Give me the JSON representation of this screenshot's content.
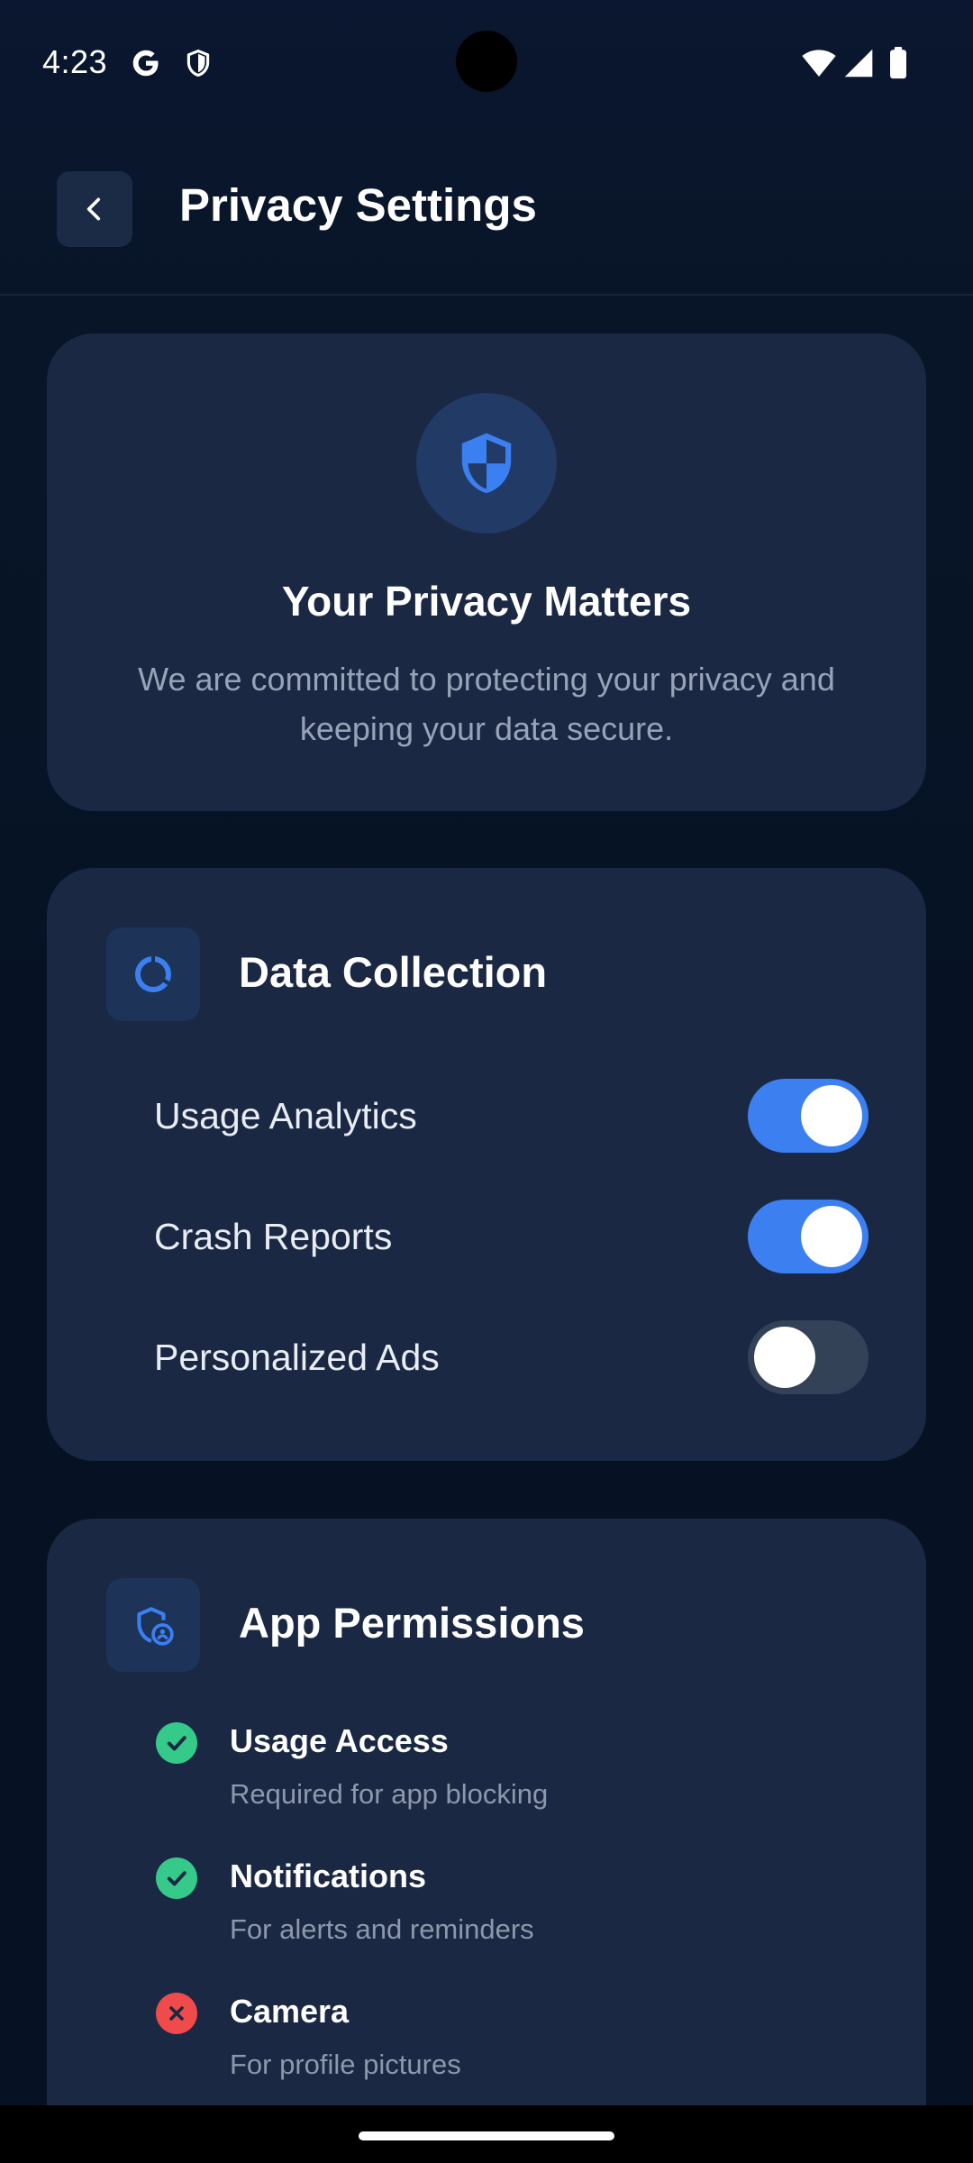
{
  "status_bar": {
    "time": "4:23",
    "left_icons": [
      "google-icon",
      "shield-status-icon"
    ],
    "right_icons": [
      "wifi-icon",
      "cell-signal-icon",
      "battery-icon"
    ]
  },
  "app_bar": {
    "title": "Privacy Settings",
    "back_icon": "chevron-left-icon"
  },
  "hero": {
    "icon": "shield-icon",
    "title": "Your Privacy Matters",
    "description": "We are committed to protecting your privacy and keeping your data secure."
  },
  "data_collection": {
    "icon": "data-usage-icon",
    "title": "Data Collection",
    "items": [
      {
        "label": "Usage Analytics",
        "enabled": true
      },
      {
        "label": "Crash Reports",
        "enabled": true
      },
      {
        "label": "Personalized Ads",
        "enabled": false
      }
    ]
  },
  "app_permissions": {
    "icon": "admin-shield-icon",
    "title": "App Permissions",
    "items": [
      {
        "title": "Usage Access",
        "description": "Required for app blocking",
        "granted": true
      },
      {
        "title": "Notifications",
        "description": "For alerts and reminders",
        "granted": true
      },
      {
        "title": "Camera",
        "description": "For profile pictures",
        "granted": false
      }
    ]
  },
  "colors": {
    "accent": "#3b7ff0",
    "granted": "#35c98a",
    "denied": "#ef4b4b",
    "card": "#1a2843",
    "background": "#071428"
  }
}
